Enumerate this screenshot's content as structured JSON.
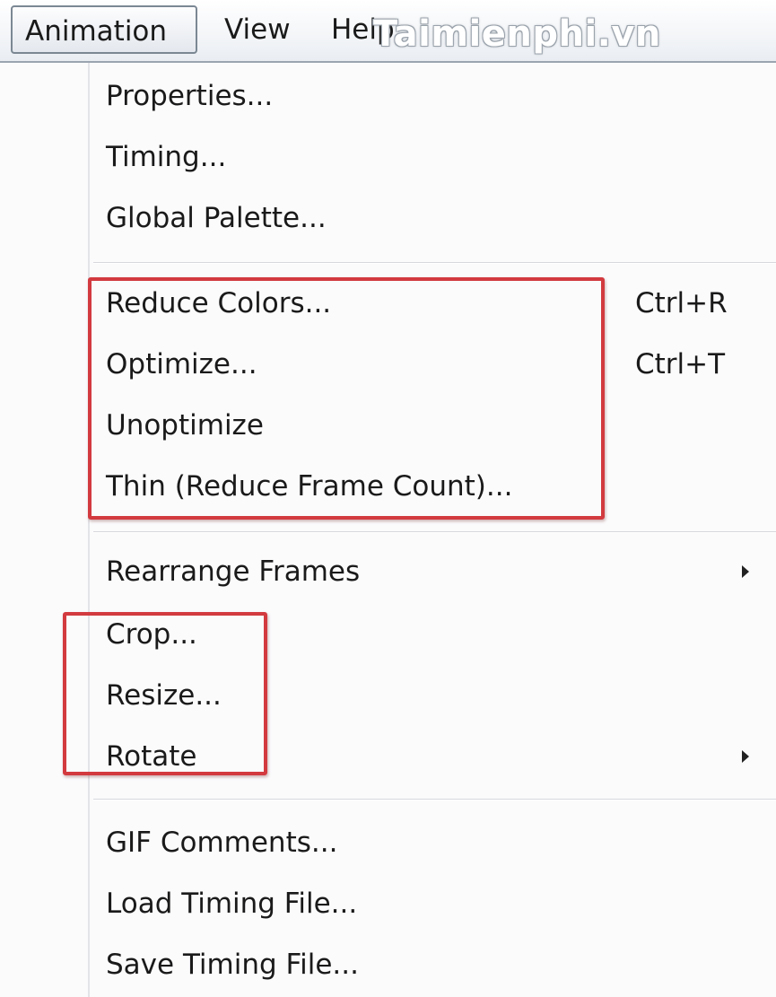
{
  "menubar": {
    "menus": [
      {
        "label": "Animation",
        "active": true
      },
      {
        "label": "View",
        "active": false
      },
      {
        "label": "Help",
        "active": false
      }
    ],
    "watermark": "Taimienphi.vn"
  },
  "dropdown": {
    "groups": [
      [
        {
          "label": "Properties..."
        },
        {
          "label": "Timing..."
        },
        {
          "label": "Global Palette..."
        }
      ],
      [
        {
          "label": "Reduce Colors...",
          "shortcut": "Ctrl+R"
        },
        {
          "label": "Optimize...",
          "shortcut": "Ctrl+T"
        },
        {
          "label": "Unoptimize"
        },
        {
          "label": "Thin (Reduce Frame Count)..."
        }
      ],
      [
        {
          "label": "Rearrange Frames",
          "submenu": true
        },
        {
          "label": "Crop..."
        },
        {
          "label": "Resize..."
        },
        {
          "label": "Rotate",
          "submenu": true
        }
      ],
      [
        {
          "label": "GIF Comments..."
        },
        {
          "label": "Load Timing File..."
        },
        {
          "label": "Save Timing File..."
        }
      ]
    ]
  },
  "colors": {
    "highlight": "#d23a3f",
    "menu_background": "#fbfbfc",
    "text": "#1a1a1a"
  },
  "icons": {
    "submenu": "triangle-right-icon"
  }
}
